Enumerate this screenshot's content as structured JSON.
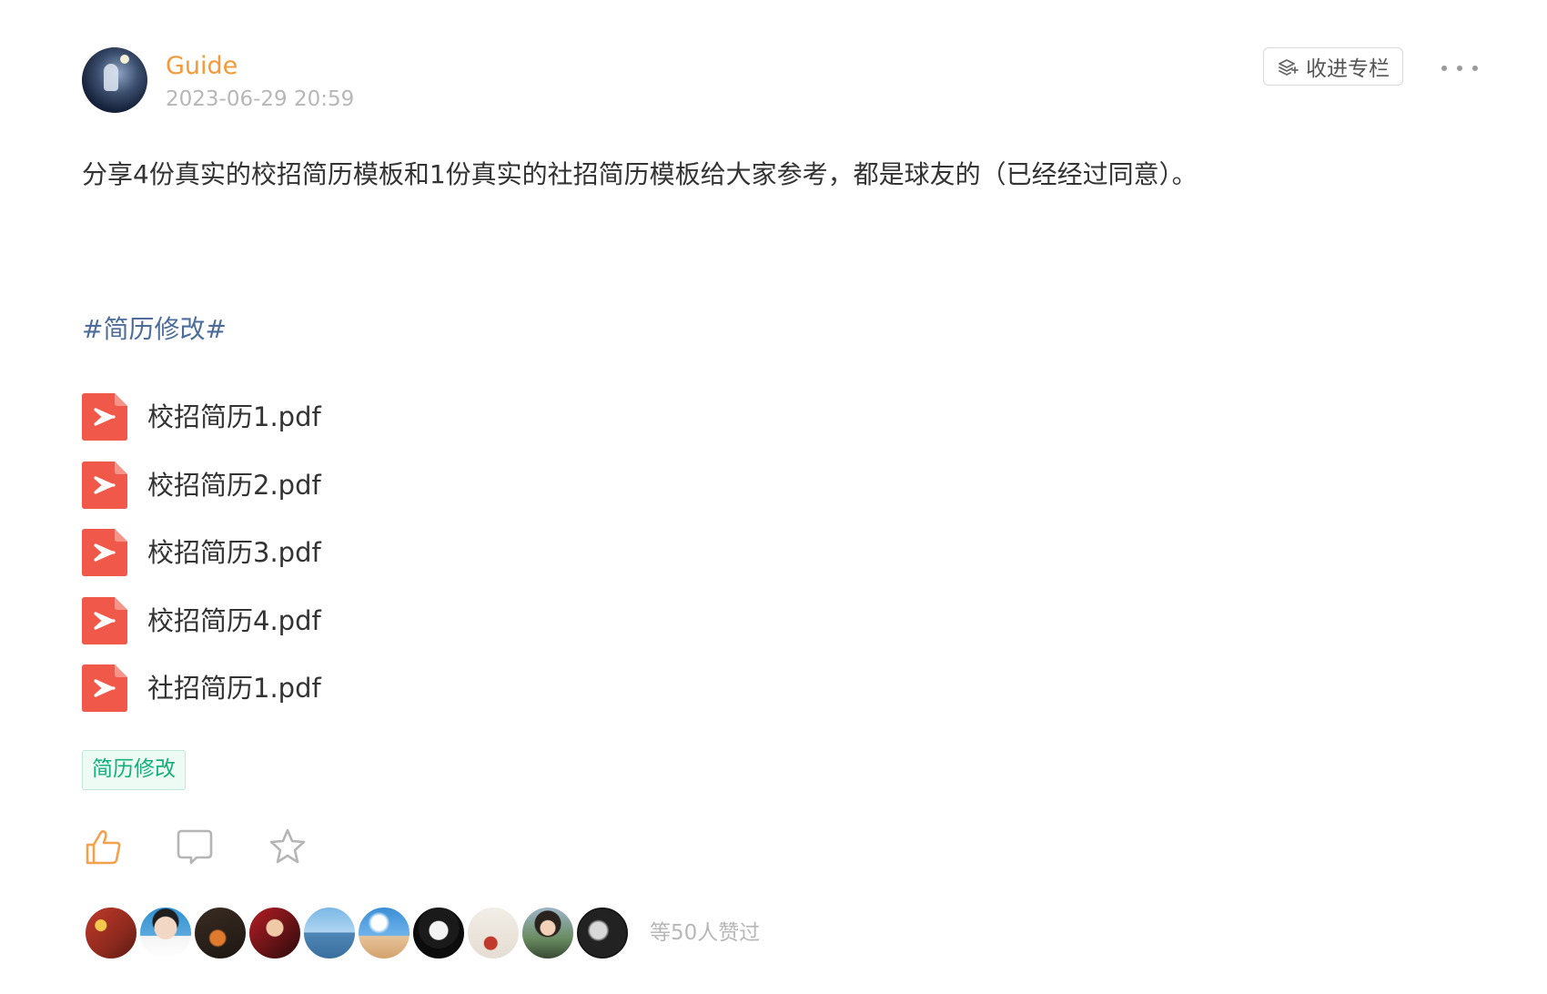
{
  "author": {
    "name": "Guide",
    "time": "2023-06-29 20:59",
    "avatar_icon": "avatar-night-sky"
  },
  "header_actions": {
    "collect_label": "收进专栏",
    "collect_icon": "layers-plus-icon",
    "more_icon": "more-dots-icon"
  },
  "content": {
    "text": "分享4份真实的校招简历模板和1份真实的社招简历模板给大家参考，都是球友的（已经经过同意）。",
    "hashtag": "#简历修改#"
  },
  "attachments": [
    {
      "name": "校招简历1.pdf",
      "icon": "pdf-icon"
    },
    {
      "name": "校招简历2.pdf",
      "icon": "pdf-icon"
    },
    {
      "name": "校招简历3.pdf",
      "icon": "pdf-icon"
    },
    {
      "name": "校招简历4.pdf",
      "icon": "pdf-icon"
    },
    {
      "name": "社招简历1.pdf",
      "icon": "pdf-icon"
    }
  ],
  "tag": "简历修改",
  "actions": {
    "like_icon": "thumbs-up-icon",
    "comment_icon": "comment-icon",
    "favorite_icon": "star-icon"
  },
  "likes": {
    "summary": "等50人赞过",
    "visible_avatars": 10
  },
  "colors": {
    "author": "#f39a3a",
    "hashtag": "#4c6d9a",
    "tag_text": "#13b07c",
    "tag_bg": "#eefaf4",
    "pdf": "#f0584a",
    "like_active": "#f5a04a"
  }
}
